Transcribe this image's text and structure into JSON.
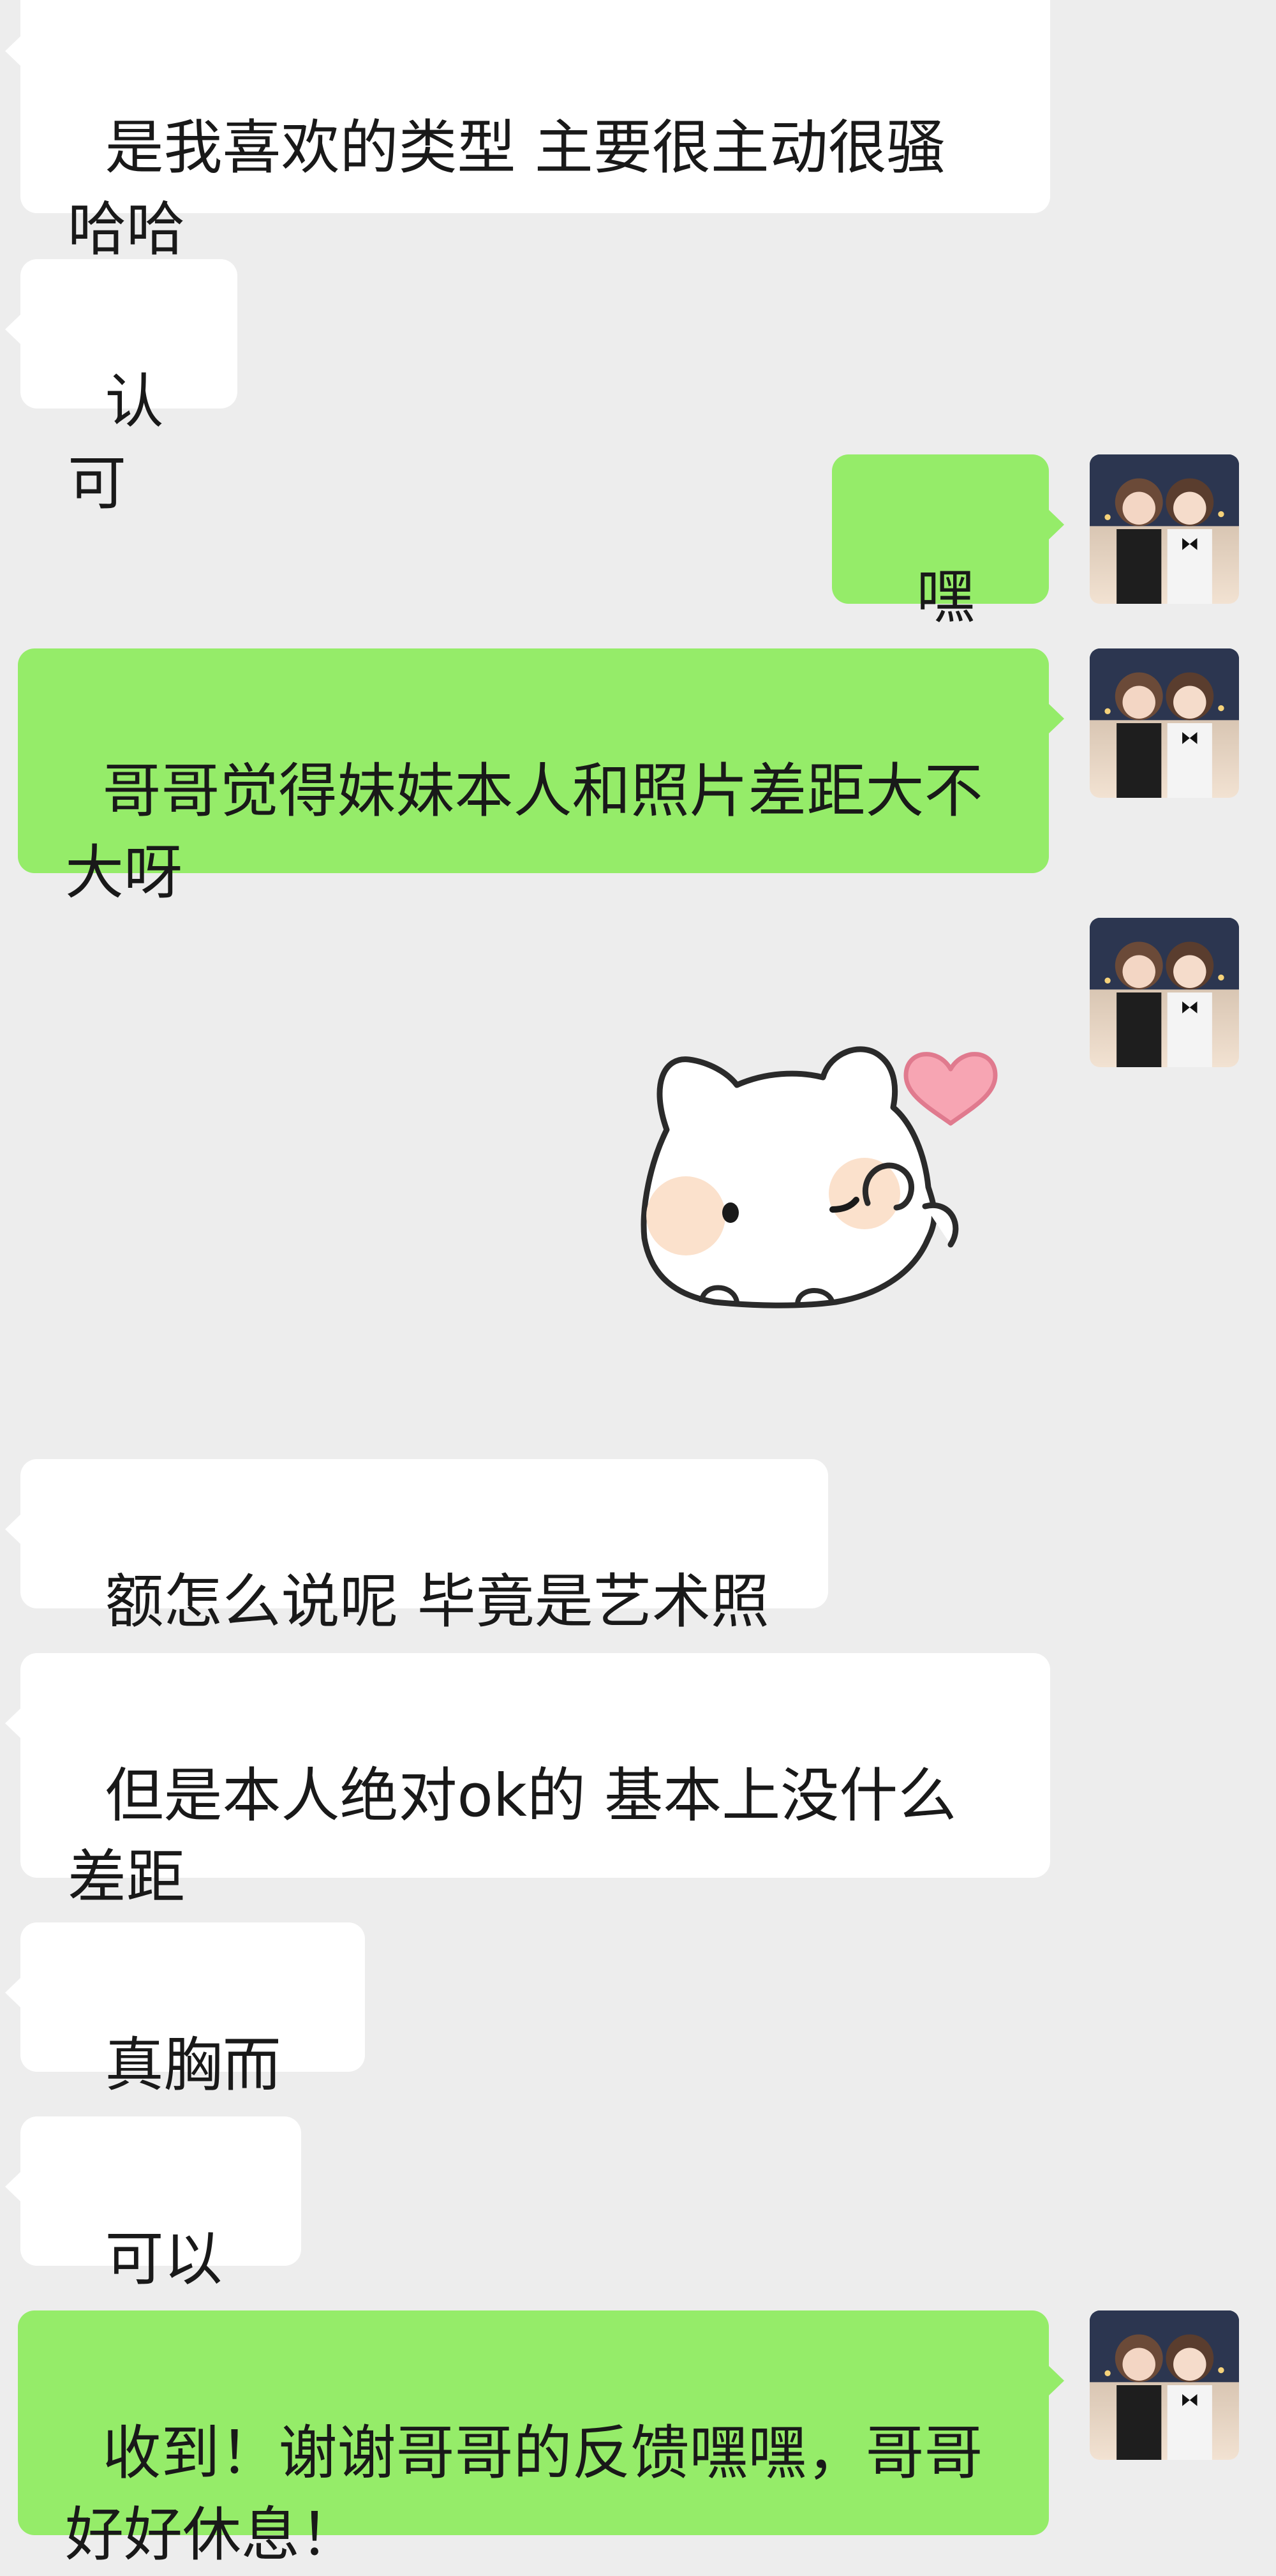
{
  "messages": [
    {
      "side": "in",
      "text": "是我喜欢的类型 主要很主动很骚哈哈"
    },
    {
      "side": "in",
      "text": "认可"
    },
    {
      "side": "out",
      "text": "嘿嘿"
    },
    {
      "side": "out",
      "text": "哥哥觉得妹妹本人和照片差距大不大呀"
    },
    {
      "side": "out",
      "type": "sticker",
      "sticker_name": "cat-heart-sticker"
    },
    {
      "side": "in",
      "text": "额怎么说呢 毕竟是艺术照"
    },
    {
      "side": "in",
      "text": "但是本人绝对ok的 基本上没什么差距"
    },
    {
      "side": "in",
      "text": "真胸而且"
    },
    {
      "side": "in",
      "text": "可以的"
    },
    {
      "side": "out",
      "text": "收到！谢谢哥哥的反馈嘿嘿，哥哥好好休息！"
    }
  ],
  "colors": {
    "background": "#ededed",
    "incoming_bubble": "#ffffff",
    "outgoing_bubble": "#95ec69",
    "text": "#191919"
  }
}
